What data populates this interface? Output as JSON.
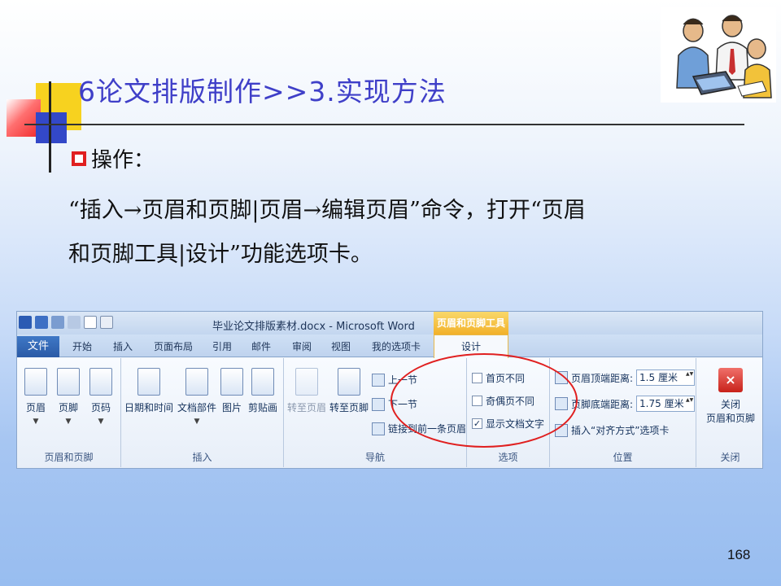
{
  "slide": {
    "title": "6论文排版制作>>3.实现方法",
    "bullet": "操作：",
    "paragraph_line1": "“插入→页眉和页脚|页眉→编辑页眉”命令，打开“页眉",
    "paragraph_line2": "和页脚工具|设计”功能选项卡。",
    "page_number": "168",
    "accent_title_color": "#3f3fc8",
    "annotation_color": "#e02020"
  },
  "ribbon": {
    "window_title": "毕业论文排版素材.docx - Microsoft Word",
    "context_tab_title": "页眉和页脚工具",
    "tabs": [
      "文件",
      "开始",
      "插入",
      "页面布局",
      "引用",
      "邮件",
      "审阅",
      "视图",
      "我的选项卡",
      "设计"
    ],
    "groups": {
      "header_footer": {
        "label": "页眉和页脚",
        "buttons": [
          "页眉",
          "页脚",
          "页码"
        ]
      },
      "insert": {
        "label": "插入",
        "buttons": [
          "日期和时间",
          "文档部件",
          "图片",
          "剪贴画"
        ]
      },
      "navigation": {
        "label": "导航",
        "buttons": [
          "转至页眉",
          "转至页脚"
        ],
        "small": [
          "上一节",
          "下一节",
          "链接到前一条页眉"
        ]
      },
      "options": {
        "label": "选项",
        "checkboxes": [
          {
            "label": "首页不同",
            "checked": false
          },
          {
            "label": "奇偶页不同",
            "checked": false
          },
          {
            "label": "显示文档文字",
            "checked": true
          }
        ]
      },
      "position": {
        "label": "位置",
        "header_distance_label": "页眉顶端距离:",
        "header_distance_value": "1.5 厘米",
        "footer_distance_label": "页脚底端距离:",
        "footer_distance_value": "1.75 厘米",
        "align_tab": "插入“对齐方式”选项卡"
      },
      "close": {
        "label": "关闭",
        "button_line1": "关闭",
        "button_line2": "页眉和页脚"
      }
    }
  }
}
